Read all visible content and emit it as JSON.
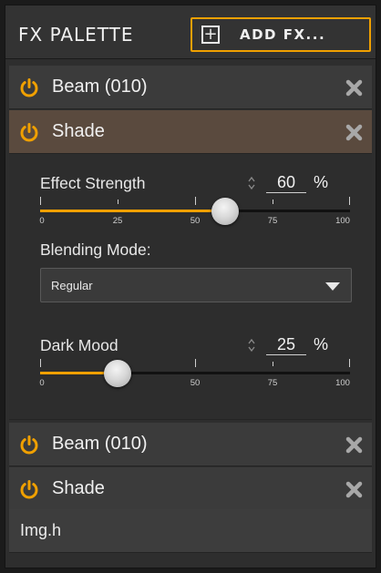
{
  "header": {
    "title": "FX PALETTE",
    "add_button_label": "ADD FX..."
  },
  "effects": [
    {
      "label": "Beam (010)",
      "enabled": true,
      "selected": false
    },
    {
      "label": "Shade",
      "enabled": true,
      "selected": true
    },
    {
      "label": "Beam (010)",
      "enabled": true,
      "selected": false
    },
    {
      "label": "Shade",
      "enabled": true,
      "selected": false
    }
  ],
  "shade_panel": {
    "effect_strength": {
      "label": "Effect Strength",
      "value": "60",
      "unit": "%",
      "tick_labels": [
        "0",
        "25",
        "50",
        "75",
        "100"
      ]
    },
    "blending_mode": {
      "label": "Blending Mode:",
      "selected": "Regular"
    },
    "dark_mood": {
      "label": "Dark Mood",
      "value": "25",
      "unit": "%",
      "tick_labels": [
        "0",
        "50",
        "75",
        "100"
      ]
    }
  },
  "image_item": {
    "label": "Img.h"
  },
  "icons": {
    "power": "power-icon",
    "close": "close-icon",
    "plus": "plus-icon",
    "spin": "spin-arrows-icon",
    "dropdown": "chevron-down-icon"
  },
  "colors": {
    "accent": "#f0a000",
    "selected_row": "#5a4a3e",
    "row": "#3b3b3b",
    "panel": "#2d2d2d"
  }
}
